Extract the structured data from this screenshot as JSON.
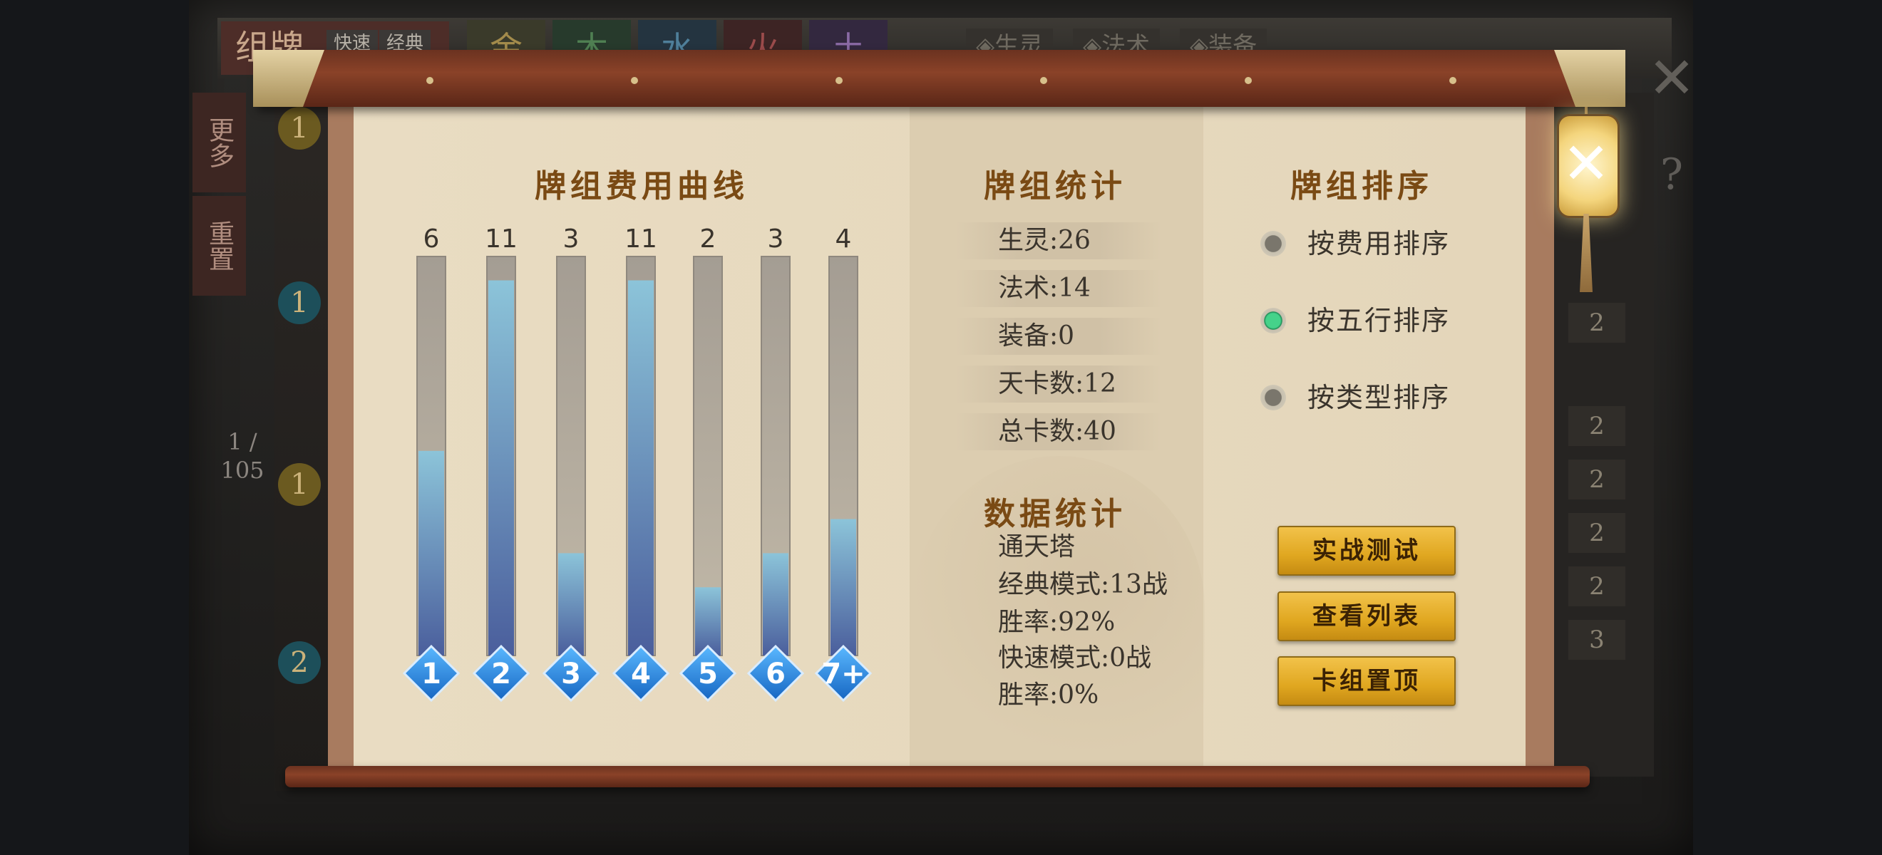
{
  "background": {
    "deck_title": "组牌",
    "tag_quick": "快速",
    "tag_classic": "经典",
    "element_tabs": [
      "金",
      "木",
      "水",
      "火",
      "土"
    ],
    "filters": [
      "◈生灵",
      "◈法术",
      "◈装备"
    ],
    "side_more": "更多",
    "side_reset": "重置",
    "page": "1 / 105",
    "badges": [
      "1",
      "1",
      "1",
      "2"
    ],
    "right_counts": [
      "2",
      "2",
      "2",
      "2",
      "2",
      "3"
    ],
    "close_glyph": "✕",
    "help_glyph": "?"
  },
  "cost_curve": {
    "title": "牌组费用曲线"
  },
  "chart_data": {
    "type": "bar",
    "title": "牌组费用曲线",
    "categories": [
      "1",
      "2",
      "3",
      "4",
      "5",
      "6",
      "7+"
    ],
    "values": [
      6,
      11,
      3,
      11,
      2,
      3,
      4
    ],
    "ylim": [
      0,
      11.7
    ],
    "colors": {
      "track": "#a69f95",
      "fill_top": "#8cc4d9",
      "fill_bottom": "#4a5e9c",
      "gem": "#2a8ee6"
    }
  },
  "deck_stats": {
    "title": "牌组统计",
    "rows": [
      "生灵:26",
      "法术:14",
      "装备:0",
      "天卡数:12",
      "总卡数:40"
    ]
  },
  "data_stats": {
    "title": "数据统计",
    "lines": [
      "通天塔",
      "经典模式:13战",
      "胜率:92%",
      "快速模式:0战",
      "胜率:0%"
    ]
  },
  "deck_sort": {
    "title": "牌组排序",
    "options": [
      {
        "label": "按费用排序",
        "checked": false
      },
      {
        "label": "按五行排序",
        "checked": true
      },
      {
        "label": "按类型排序",
        "checked": false
      }
    ]
  },
  "actions": {
    "test": "实战测试",
    "list": "查看列表",
    "pin": "卡组置顶"
  },
  "close": {
    "glyph": "✕"
  }
}
